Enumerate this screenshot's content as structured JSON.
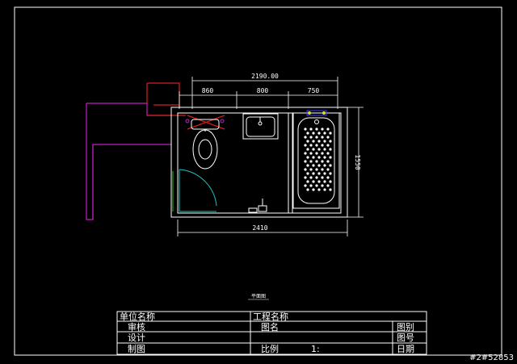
{
  "drawing": {
    "dimensions": {
      "overall_top": "2190.00",
      "seg1": "860",
      "seg2": "800",
      "seg3": "750",
      "height_right": "1550",
      "bottom": "2410"
    },
    "plan_title": "平面图"
  },
  "title_block": {
    "unit_name": "单位名称",
    "project_name": "工程名称",
    "review": "审核",
    "design": "设计",
    "draw": "制图",
    "drawing_name": "图名",
    "drawing_number": "图号",
    "scale_label": "比例",
    "scale_value": "1:",
    "category": "图别",
    "date": "日期",
    "extra": "日期"
  },
  "watermark": "#2#52853",
  "colors": {
    "background": "#000000",
    "frame": "#ffffff",
    "dimension": "#ffffff",
    "wall_red": "#d02020",
    "magenta": "#c020c0",
    "cyan": "#20c0c0",
    "yellow": "#e0e020",
    "green": "#20c020",
    "blue": "#4040ff"
  }
}
